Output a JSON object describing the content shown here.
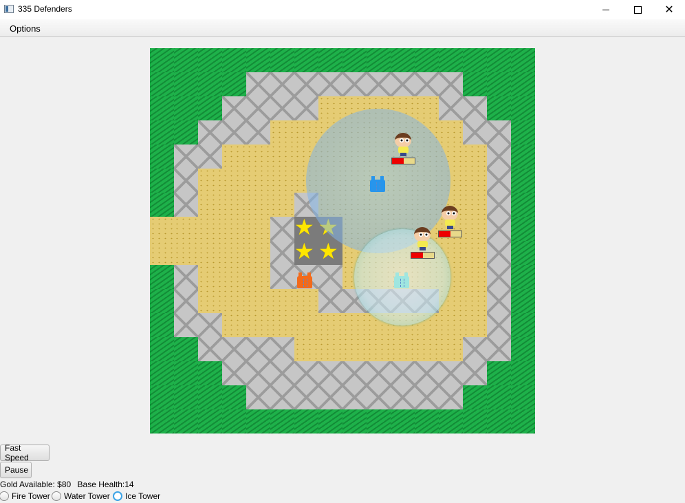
{
  "window": {
    "title": "335 Defenders"
  },
  "menu": {
    "options_label": "Options"
  },
  "board": {
    "map_rows": [
      "GGGGGGGGGGGGGGGG",
      "GGGGSSSSSSSSSGGG",
      "GGGSSSSTTTTTSSGG",
      "GGSSSTTTTTTTTSSG",
      "GSSTTTTTTTTTTTSG",
      "GSTTTTTTTTTTTTSG",
      "GSTTTTSTTTTTTTSG",
      "TTTTTSBBTTTTTTSG",
      "TTTTTSBBTTTTTTSG",
      "GSTTTSSSTTTTTTSG",
      "GSTTTTTSSSSSTTSG",
      "GSSTTTTTTTTTTTSG",
      "GGSSSSTTTTTTTSSG",
      "GGGSSSSSSSSSSSGG",
      "GGGGSSSSSSSSSGGG",
      "GGGGGGGGGGGGGGGG"
    ],
    "base": {
      "stars": 4,
      "star_glyph": "★"
    },
    "towers": [
      {
        "type": "fire",
        "color": "#f36a1a"
      },
      {
        "type": "water",
        "color": "#2795ec"
      },
      {
        "type": "ice",
        "color": "#9fe6e0"
      }
    ],
    "enemies": [
      {
        "name": "enemy-1",
        "health_fraction": 0.5
      },
      {
        "name": "enemy-2",
        "health_fraction": 0.5
      },
      {
        "name": "enemy-3",
        "health_fraction": 0.5
      }
    ]
  },
  "controls": {
    "fast_speed_label": "Fast Speed",
    "pause_label": "Pause",
    "gold_text": "Gold Available: $80",
    "health_text": "Base Health:14",
    "tower_options": [
      {
        "label": "Fire Tower",
        "selected": false
      },
      {
        "label": "Water Tower",
        "selected": false
      },
      {
        "label": "Ice Tower",
        "selected": true
      }
    ]
  },
  "colors": {
    "grass": "#1eb14a",
    "stone": "#c6c6c6",
    "sand": "#e5cc74",
    "hp_red": "#ee0000",
    "star": "#ffe600",
    "radio_accent": "#3ba3e6"
  }
}
